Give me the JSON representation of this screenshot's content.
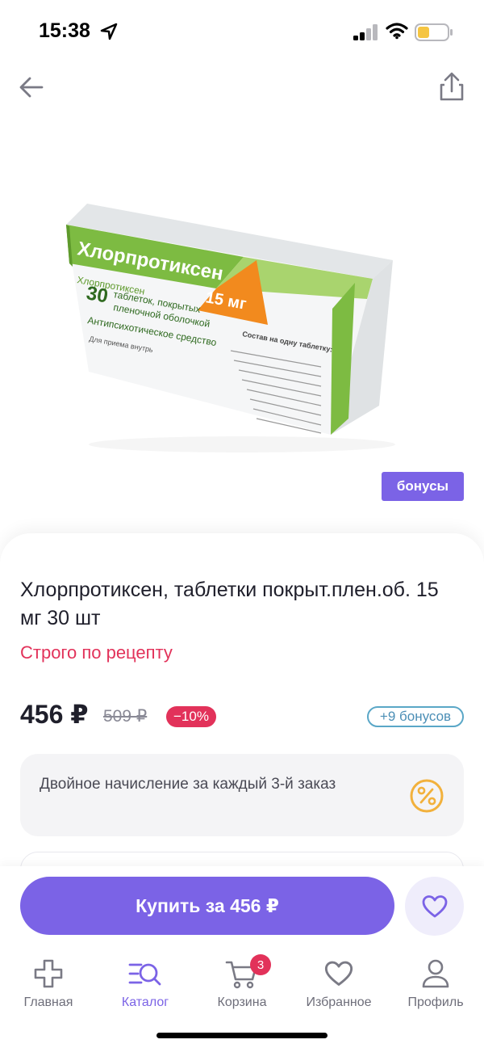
{
  "status_bar": {
    "time": "15:38"
  },
  "product": {
    "box_brand": "Хлорпротиксен",
    "box_inn": "Хлорпротиксен",
    "box_count": "30",
    "box_desc_line1": "таблеток, покрытых",
    "box_desc_line2": "пленочной оболочкой",
    "box_class": "Антипсихотическое средство",
    "box_route": "Для приема внутрь",
    "box_dose": "15 мг",
    "box_composition_title": "Состав на одну таблетку:",
    "title": "Хлорпротиксен, таблетки покрыт.плен.об. 15 мг 30 шт",
    "rx_note": "Строго по рецепту",
    "bonus_tag": "бонусы",
    "price": "456 ₽",
    "old_price": "509 ₽",
    "discount": "−10%",
    "bonus_earn": "+9 бонусов"
  },
  "promo": {
    "text": "Двойное начисление за каждый 3-й заказ",
    "icon": "percent-icon"
  },
  "actions": {
    "buy_label": "Купить за 456 ₽",
    "favorite_icon": "heart-icon"
  },
  "nav": {
    "items": [
      {
        "label": "Главная",
        "icon": "plus-cross-icon"
      },
      {
        "label": "Каталог",
        "icon": "catalog-search-icon"
      },
      {
        "label": "Корзина",
        "icon": "cart-icon",
        "badge": "3"
      },
      {
        "label": "Избранное",
        "icon": "heart-icon"
      },
      {
        "label": "Профиль",
        "icon": "profile-icon"
      }
    ],
    "active_index": 1
  },
  "colors": {
    "accent": "#7b63e6",
    "danger": "#e2325a",
    "bonus": "#5aa7c7",
    "promo_icon": "#f2b13c"
  }
}
